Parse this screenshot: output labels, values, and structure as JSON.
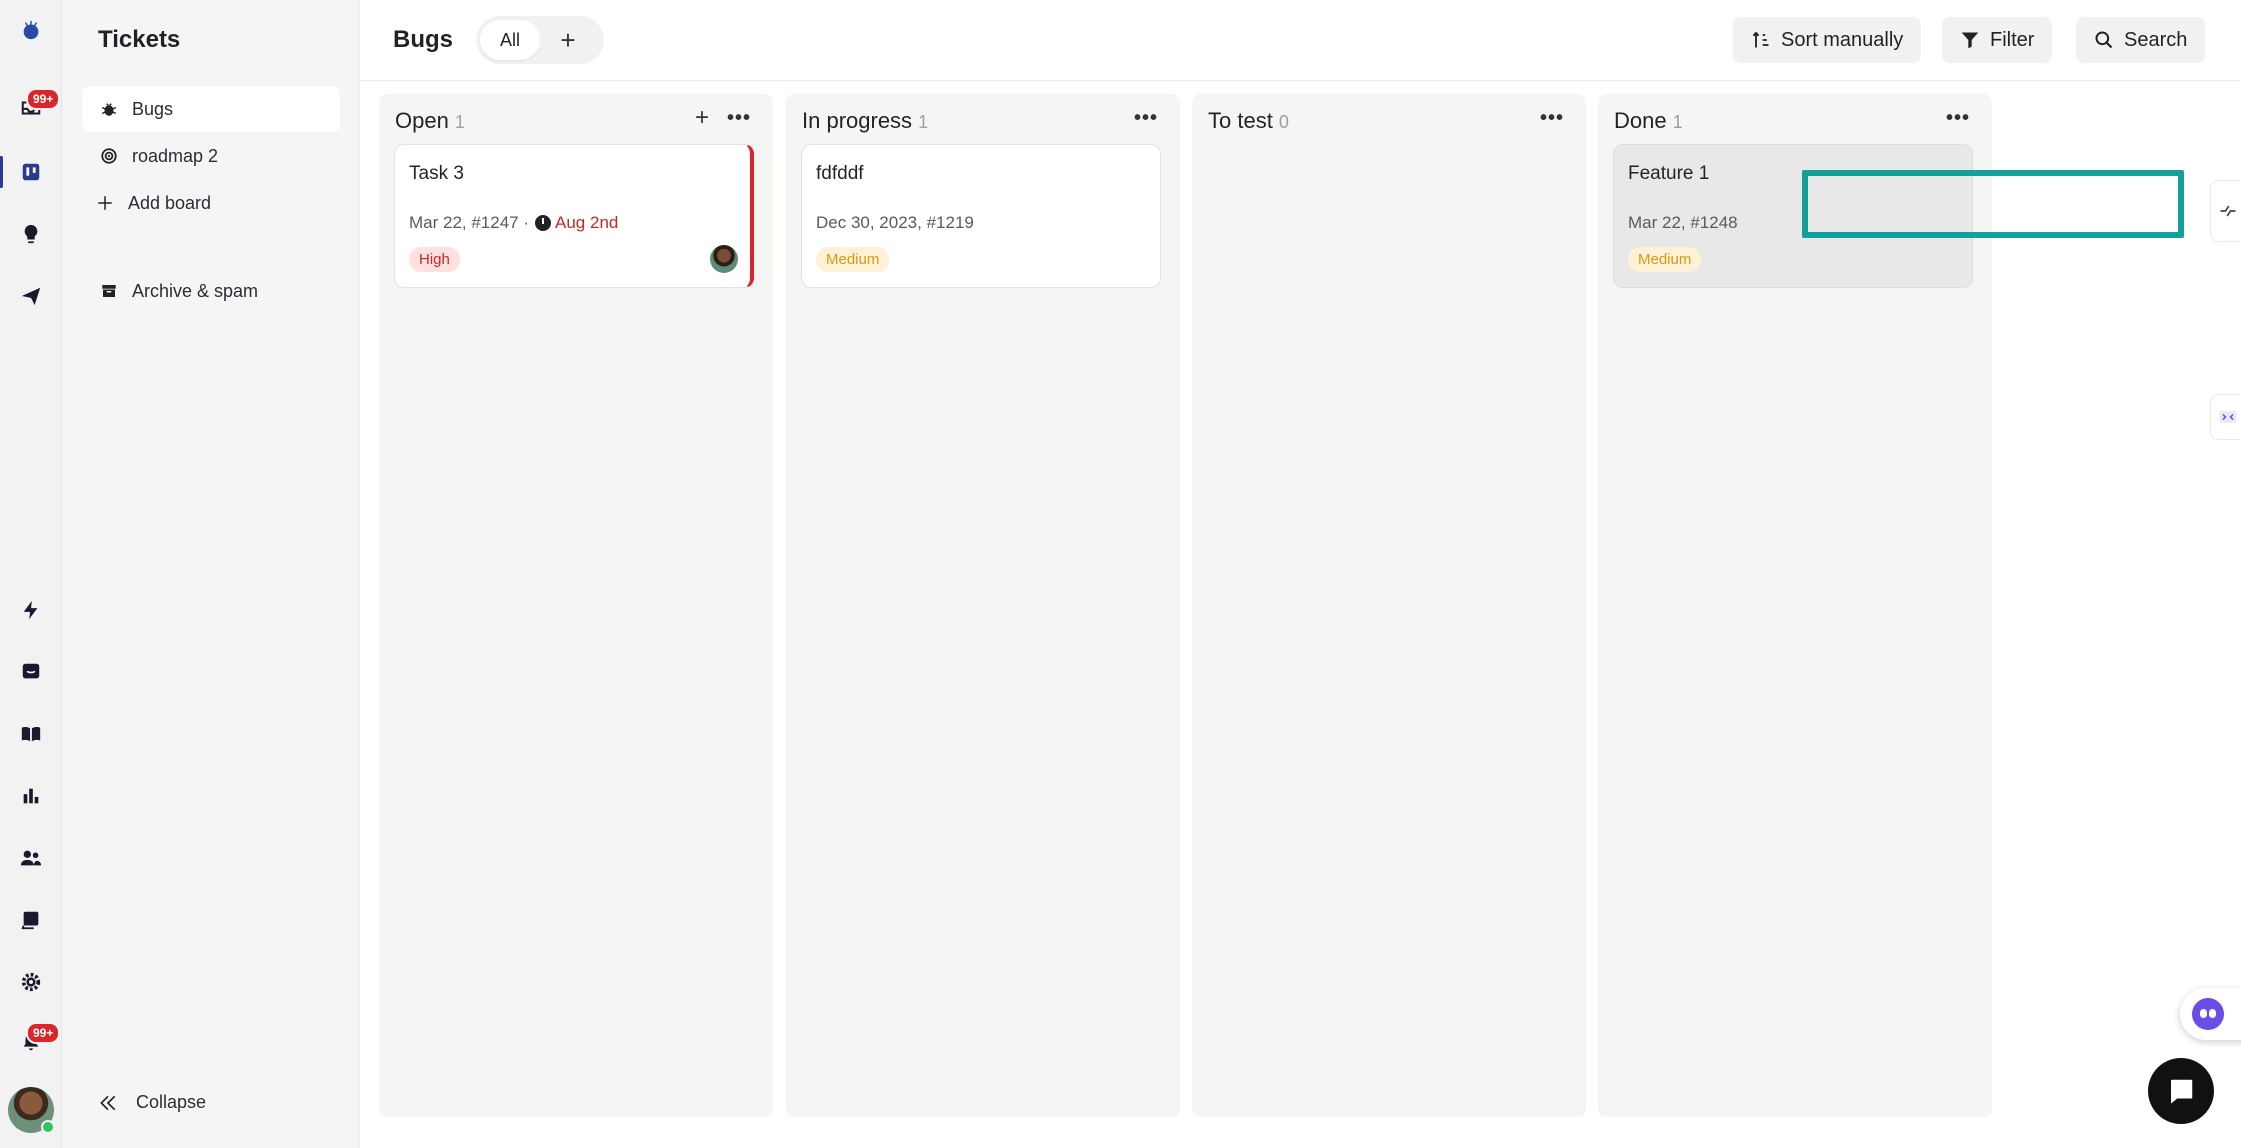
{
  "rail": {
    "inbox_badge": "99+",
    "notifications_badge": "99+"
  },
  "sidebar": {
    "title": "Tickets",
    "items": [
      {
        "label": "Bugs",
        "icon": "bug-icon"
      },
      {
        "label": "roadmap 2",
        "icon": "target-icon"
      },
      {
        "label": "Add board",
        "icon": "plus-icon"
      },
      {
        "label": "Archive & spam",
        "icon": "archive-icon"
      }
    ],
    "collapse_label": "Collapse"
  },
  "header": {
    "title": "Bugs",
    "tab_all": "All",
    "tab_add": "+",
    "sort_label": "Sort manually",
    "filter_label": "Filter",
    "search_label": "Search"
  },
  "columns": [
    {
      "title": "Open",
      "count": "1",
      "cards": [
        {
          "title": "Task 3",
          "meta": "Mar 22, #1247 ·",
          "due": "Aug 2nd",
          "priority": "High"
        }
      ]
    },
    {
      "title": "In progress",
      "count": "1",
      "cards": [
        {
          "title": "fdfddf",
          "meta": "Dec 30, 2023, #1219",
          "priority": "Medium"
        }
      ]
    },
    {
      "title": "To test",
      "count": "0",
      "cards": []
    },
    {
      "title": "Done",
      "count": "1",
      "cards": [
        {
          "title": "Feature 1",
          "meta": "Mar 22, #1248",
          "priority": "Medium"
        }
      ]
    }
  ],
  "colors": {
    "accent": "#2b3a8c",
    "badge": "#d9262b",
    "high": "#c62828",
    "medium": "#d49b14",
    "highlight": "#14a09a"
  }
}
